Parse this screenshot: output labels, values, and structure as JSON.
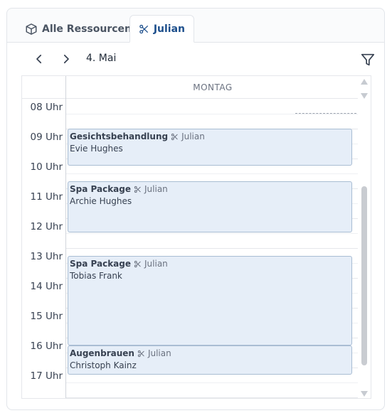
{
  "tabs": [
    {
      "label": "Alle Ressourcen",
      "icon": "cube-icon",
      "active": false
    },
    {
      "label": "Julian",
      "icon": "scissors-icon",
      "active": true
    }
  ],
  "toolbar": {
    "date": "4. Mai",
    "prev_icon": "chevron-left-icon",
    "next_icon": "chevron-right-icon",
    "filter_icon": "filter-icon"
  },
  "calendar": {
    "day_header": "MONTAG",
    "hours": [
      "08 Uhr",
      "09 Uhr",
      "10 Uhr",
      "11 Uhr",
      "12 Uhr",
      "13 Uhr",
      "14 Uhr",
      "15 Uhr",
      "16 Uhr",
      "17 Uhr"
    ],
    "events": [
      {
        "title": "Gesichtsbehandlung",
        "resource": "Julian",
        "customer": "Evie Hughes"
      },
      {
        "title": "Spa Package",
        "resource": "Julian",
        "customer": "Archie Hughes"
      },
      {
        "title": "Spa Package",
        "resource": "Julian",
        "customer": "Tobias Frank"
      },
      {
        "title": "Augenbrauen",
        "resource": "Julian",
        "customer": "Christoph Kainz"
      }
    ]
  },
  "colors": {
    "accent": "#1d4f8c",
    "event_bg": "#e6eef8",
    "event_border": "#a9bdd3"
  }
}
